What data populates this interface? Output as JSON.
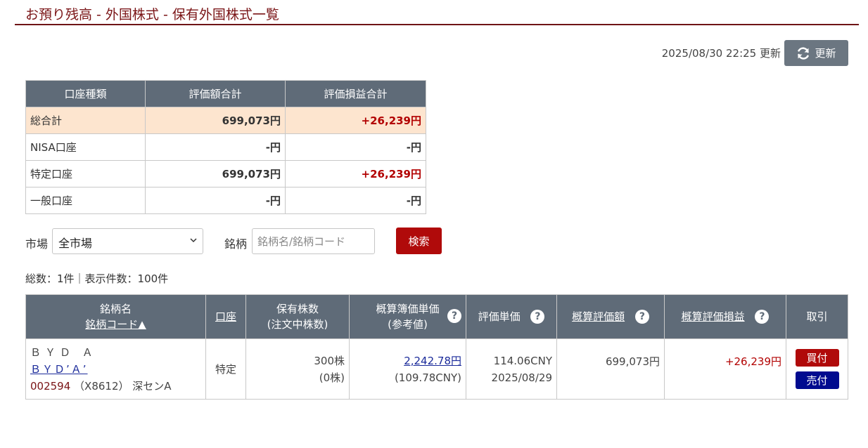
{
  "page": {
    "title": "お預り残高 - 外国株式 - 保有外国株式一覧",
    "updated_text": "2025/08/30 22:25 更新",
    "update_button": "更新"
  },
  "summary": {
    "headers": [
      "口座種類",
      "評価額合計",
      "評価損益合計"
    ],
    "rows": [
      {
        "type": "総合計",
        "value": "699,073円",
        "pl": "+26,239円"
      },
      {
        "type": "NISA口座",
        "value": "-円",
        "pl": "-円"
      },
      {
        "type": "特定口座",
        "value": "699,073円",
        "pl": "+26,239円"
      },
      {
        "type": "一般口座",
        "value": "-円",
        "pl": "-円"
      }
    ]
  },
  "filter": {
    "market_label": "市場",
    "market_value": "全市場",
    "stock_label": "銘柄",
    "stock_placeholder": "銘柄名/銘柄コード",
    "search_button": "検索"
  },
  "count_text": "総数：1件｜表示件数：100件",
  "holdings": {
    "headers": {
      "name_line1": "銘柄名",
      "name_line2": "銘柄コード▲",
      "account": "口座",
      "shares_line1": "保有株数",
      "shares_line2": "(注文中株数)",
      "cost_line1": "概算簿価単価",
      "cost_line2": "(参考値)",
      "unit_price": "評価単価",
      "est_value": "概算評価額",
      "est_pl": "概算評価損益",
      "trade": "取引",
      "help": "?"
    },
    "rows": [
      {
        "name_plain": "ＢＹＤ Ａ",
        "name_link": "ＢＹＤʼＡʼ",
        "code": "002594",
        "code_sub": "（X8612） 深センA",
        "account": "特定",
        "shares": "300株",
        "pending": "(0株)",
        "cost": "2,242.78円",
        "cost_ref": "(109.78CNY)",
        "unit_price": "114.06CNY",
        "unit_date": "2025/08/29",
        "est_value": "699,073円",
        "est_pl": "+26,239円",
        "buy": "買付",
        "sell": "売付"
      }
    ]
  },
  "colors": {
    "brand": "#7a1416",
    "header_bg": "#5f6b78",
    "total_row_bg": "#fde5cf",
    "profit_red": "#b20000",
    "buy_button": "#b00a0a",
    "sell_button": "#000b8f",
    "link_blue": "#1a2a9a"
  }
}
